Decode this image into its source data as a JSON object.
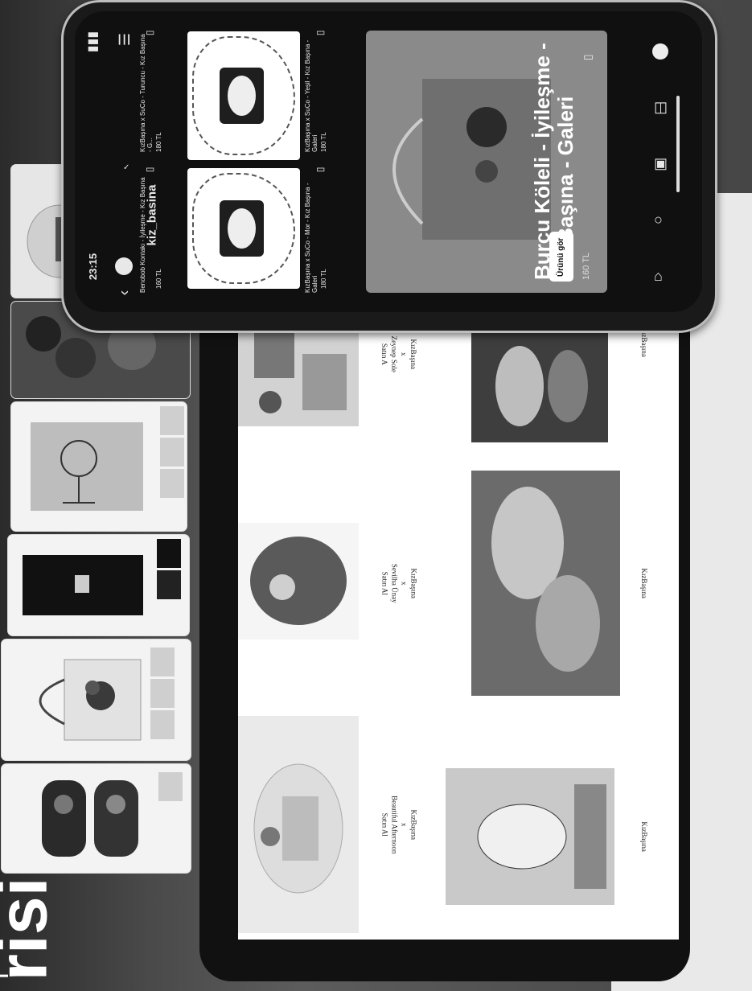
{
  "colors": {
    "phone_bg": "#101010",
    "tablet_bg": "#111111",
    "accent_white": "#ffffff"
  },
  "background": {
    "title_big": "risi",
    "title_small": "i"
  },
  "tablet": {
    "cells": [
      {
        "brand": "KızBaşına",
        "sep": "x",
        "name": "Beautiful Afternoon",
        "action": "Satın Al"
      },
      {
        "brand": "KızBaşına",
        "sep": "x",
        "name": "Sevilha Ünay",
        "action": "Satın Al"
      },
      {
        "brand": "KızBaşına",
        "sep": "x",
        "name": "Zeynep Sole",
        "action": "Satın A"
      },
      {
        "brand": "KızBaşına"
      },
      {
        "brand": "KızBaşına"
      },
      {
        "brand": "KızBaşına"
      }
    ]
  },
  "phone": {
    "status": {
      "time": "23:15"
    },
    "header": {
      "username": "kiz_basina",
      "verified_icon": "verified-icon",
      "back_icon": "back-arrow-icon",
      "menu_icon": "menu-icon"
    },
    "grid": [
      {
        "title": "Benobob Kontakı - İyileşme - Kız Başına",
        "price": "160 TL"
      },
      {
        "title": "KızBaşına x SuCo - Mor - Kız Başına - Galeri",
        "price": "180 TL"
      },
      {
        "title": "KızBaşına x SuCo - Turuncu - Kız Başına - G...",
        "price": "180 TL"
      },
      {
        "title": "KızBaşına x SuCo - Yeşil - Kız Başına - Galeri",
        "price": "180 TL"
      }
    ],
    "featured": {
      "title_line1": "Burcu Köleli - İyileşme -",
      "title_line2": "Kız Başına - Galeri",
      "price": "160 TL",
      "cta": "Ürünü gör"
    },
    "nav": [
      "home-icon",
      "search-icon",
      "reels-icon",
      "shop-icon",
      "profile-icon"
    ]
  }
}
